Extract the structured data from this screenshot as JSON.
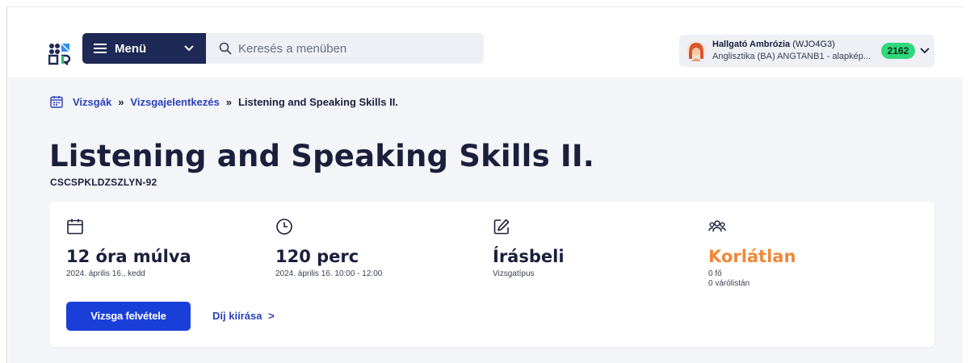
{
  "header": {
    "menu_label": "Menü",
    "search_placeholder": "Keresés a menüben",
    "user": {
      "name": "Hallgató Ambrózia",
      "code": "(WJO4G3)",
      "program": "Anglisztika (BA) ANGTANB1 - alapkép...",
      "badge": "2162"
    }
  },
  "breadcrumb": {
    "items": [
      "Vizsgák",
      "Vizsgajelentkezés"
    ],
    "separator": "»",
    "current": "Listening and Speaking Skills II."
  },
  "page": {
    "title": "Listening and Speaking Skills II.",
    "code": "CSCSPKLDZSZLYN-92"
  },
  "info": {
    "date": {
      "value": "12 óra múlva",
      "detail": "2024. április 16., kedd",
      "icon": "calendar-icon"
    },
    "duration": {
      "value": "120 perc",
      "detail": "2024. április 16. 10:00 - 12:00",
      "icon": "clock-icon"
    },
    "type": {
      "value": "Írásbeli",
      "detail": "Vizsgatípus",
      "icon": "edit-icon"
    },
    "capacity": {
      "value": "Korlátlan",
      "detail1": "0 fő",
      "detail2": "0 várólistán",
      "icon": "users-icon"
    }
  },
  "actions": {
    "primary": "Vizsga felvétele",
    "secondary": "Díj kiírása",
    "secondary_arrow": ">"
  },
  "colors": {
    "primary": "#1a3fd9",
    "navy": "#1e2955",
    "accent_orange": "#f0883a",
    "badge_green": "#2fd87a",
    "link": "#2a3fb8"
  }
}
